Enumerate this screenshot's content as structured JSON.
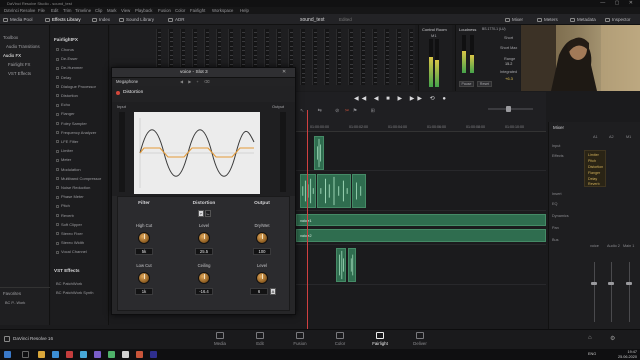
{
  "window": {
    "title": "DaVinci Resolve Studio - sound_test"
  },
  "menu": [
    "DaVinci Resolve",
    "File",
    "Edit",
    "Trim",
    "Timeline",
    "Clip",
    "Mark",
    "View",
    "Playback",
    "Fusion",
    "Color",
    "Fairlight",
    "Workspace",
    "Help"
  ],
  "toolbar": {
    "media_pool": "Media Pool",
    "effects_library": "Effects Library",
    "index": "Index",
    "sound_library": "Sound Library",
    "adr": "ADR",
    "project_title": "sound_test",
    "project_status": "Edited",
    "mixer": "Mixer",
    "meters": "Meters",
    "metadata": "Metadata",
    "inspector": "Inspector"
  },
  "toolbox": {
    "items": [
      "Toolbox",
      "Audio Transitions",
      "Audio FX",
      "Fairlight FX",
      "VST Effects"
    ],
    "favorites_label": "Favorites",
    "favorite_item": "BC P...Work"
  },
  "fx_library": {
    "header": "FairlightFX",
    "items": [
      "Chorus",
      "De-Esser",
      "De-Hummer",
      "Delay",
      "Dialogue Processor",
      "Distortion",
      "Echo",
      "Flanger",
      "Foley Sampler",
      "Frequency Analyzer",
      "LFE Filter",
      "Limiter",
      "Meter",
      "Modulation",
      "Multiband Compressor",
      "Noise Reduction",
      "Phase Meter",
      "Pitch",
      "Reverb",
      "Soft Clipper",
      "Stereo Fixer",
      "Stereo Width",
      "Vocal Channel"
    ],
    "vst_header": "VST Effects",
    "vst_items": [
      "BC PatchWork",
      "BC PatchWork Synth"
    ]
  },
  "control_room": {
    "title": "Control Room",
    "label": "M1"
  },
  "loudness": {
    "title": "Loudness",
    "standard": "BS.1770-1 (LU)",
    "short_label": "Short",
    "short_max_label": "Short Max",
    "range_label": "Range",
    "integrated_label": "Integrated",
    "pause": "Pause",
    "reset": "Reset",
    "range_value": "15.2",
    "integrated_value": "+6.3"
  },
  "plugin": {
    "title": "voice - Slot 3",
    "preset": "Megaphone",
    "module_name": "Distortion",
    "input_label": "Input",
    "output_label": "Output",
    "sections": [
      "Filter",
      "Distortion",
      "Output"
    ],
    "knobs": [
      {
        "label": "High Cut",
        "value": "5k"
      },
      {
        "label": "Low Cut",
        "value": "1k"
      },
      {
        "label": "Level",
        "value": "25.5"
      },
      {
        "label": "Ceiling",
        "value": "-16.4"
      },
      {
        "label": "Dry/Wet",
        "value": "100"
      },
      {
        "label": "Level",
        "value": "6"
      }
    ],
    "auto_button": "A"
  },
  "timeline": {
    "ruler": [
      "01:00:00:00",
      "01:00:02:00",
      "01:00:04:00",
      "01:00:06:00",
      "01:00:08:00",
      "01:00:10:00"
    ],
    "clip_labels": [
      "voice1",
      "voice2"
    ]
  },
  "mixer": {
    "title": "Mixer",
    "channels": [
      "A1",
      "A2",
      "M1"
    ],
    "rows": [
      "Input",
      "Effects",
      "Insert",
      "EQ",
      "Dynamics",
      "Pan",
      "Bus"
    ],
    "effects": [
      "Limiter",
      "Pitch",
      "Distortion",
      "Flanger",
      "Delay",
      "Reverb"
    ],
    "names": [
      "voice",
      "Audio 2",
      "Main 1"
    ]
  },
  "pages": [
    {
      "label": "Media",
      "icon": "media-icon"
    },
    {
      "label": "Edit",
      "icon": "edit-icon"
    },
    {
      "label": "Fusion",
      "icon": "fusion-icon"
    },
    {
      "label": "Color",
      "icon": "color-icon"
    },
    {
      "label": "Fairlight",
      "icon": "fairlight-icon"
    },
    {
      "label": "Deliver",
      "icon": "deliver-icon"
    }
  ],
  "app_footer": "DaVinci Resolve 16",
  "taskbar": {
    "time": "19:47",
    "date": "25.06.2020",
    "lang": "ENG"
  },
  "colors": {
    "accent": "#e1a75a",
    "clip": "#2f6d4f",
    "playhead": "#d04040",
    "effects_text": "#d2b15b"
  }
}
